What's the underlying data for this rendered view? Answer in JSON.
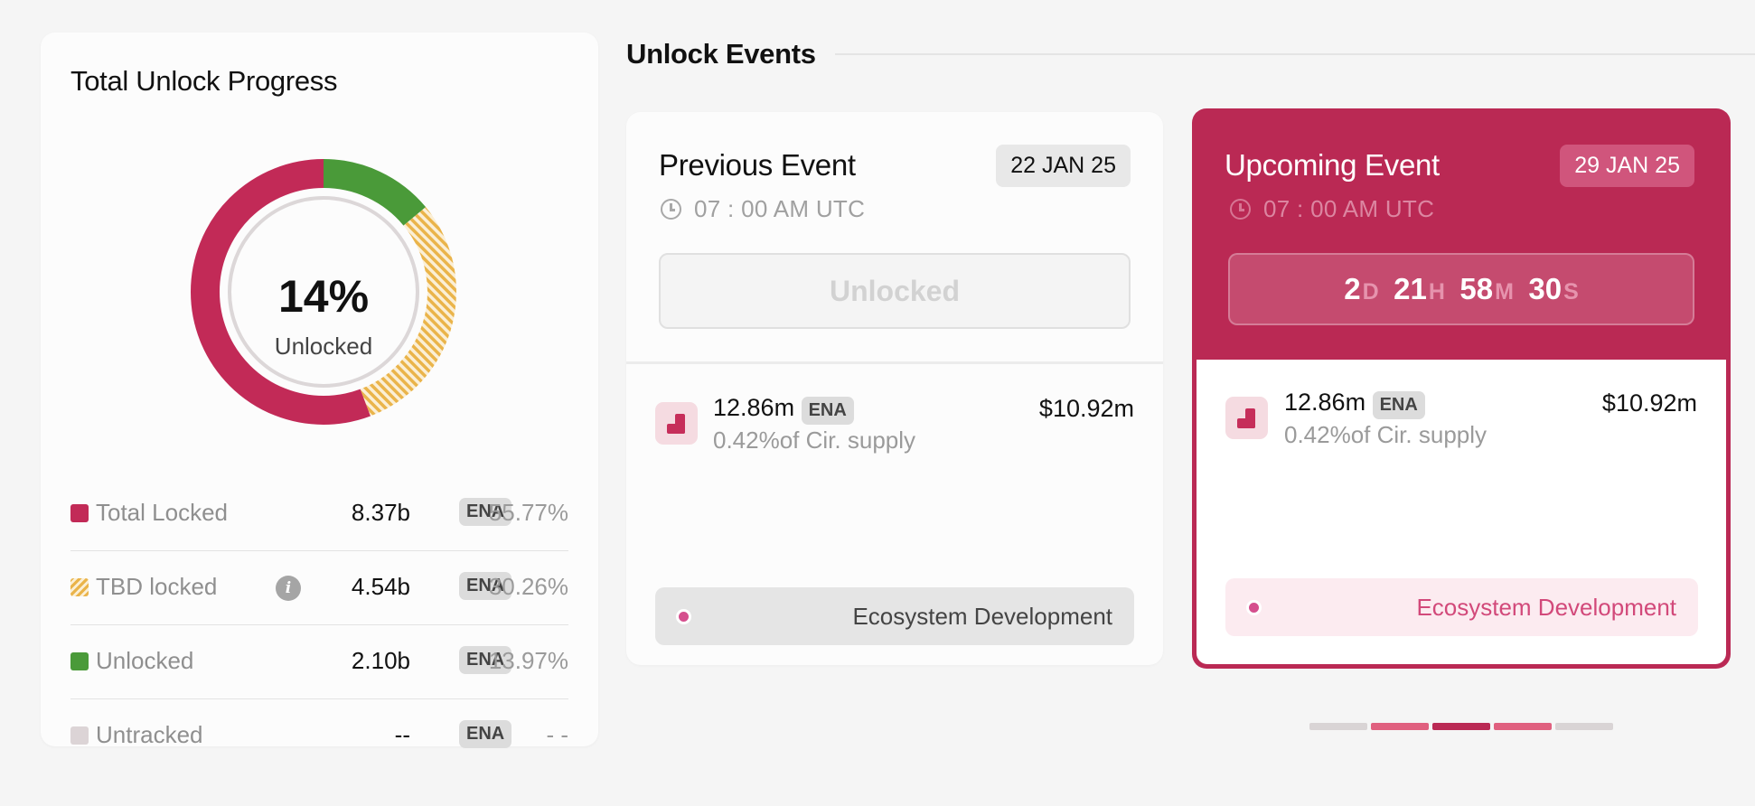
{
  "total_progress": {
    "title": "Total Unlock Progress",
    "percent_label": "14%",
    "center_label": "Unlocked",
    "segments": [
      {
        "name": "Unlocked",
        "fraction": 0.1397,
        "color": "#4a9a39"
      },
      {
        "name": "TBD locked",
        "fraction": 0.3026,
        "color": "#eab44a"
      },
      {
        "name": "Total Locked",
        "fraction": 0.5577,
        "color": "#c22a57"
      }
    ],
    "legend": [
      {
        "label": "Total Locked",
        "amount": "8.37b",
        "token": "ENA",
        "pct": "55.77%",
        "color": "#c22a57",
        "info": ""
      },
      {
        "label": "TBD locked",
        "amount": "4.54b",
        "token": "ENA",
        "pct": "30.26%",
        "color": "#eab44a",
        "info": "i"
      },
      {
        "label": "Unlocked",
        "amount": "2.10b",
        "token": "ENA",
        "pct": "13.97%",
        "color": "#4a9a39",
        "info": ""
      },
      {
        "label": "Untracked",
        "amount": "--",
        "token": "ENA",
        "pct": "- -",
        "color": "#dcd4d6",
        "info": ""
      }
    ]
  },
  "events": {
    "title": "Unlock Events",
    "previous": {
      "title": "Previous Event",
      "date": "22 JAN 25",
      "time": "07 : 00 AM UTC",
      "status": "Unlocked",
      "amount": "12.86m",
      "token": "ENA",
      "supply": "0.42%of Cir. supply",
      "usd": "$10.92m",
      "category": "Ecosystem Development"
    },
    "upcoming": {
      "title": "Upcoming Event",
      "date": "29 JAN 25",
      "time": "07 : 00 AM UTC",
      "countdown": {
        "d": "2",
        "d_unit": "D",
        "h": "21",
        "h_unit": "H",
        "m": "58",
        "m_unit": "M",
        "s": "30",
        "s_unit": "S"
      },
      "amount": "12.86m",
      "token": "ENA",
      "supply": "0.42%of Cir. supply",
      "usd": "$10.92m",
      "category": "Ecosystem Development"
    },
    "pager": {
      "count": 5,
      "active_index": 2
    }
  },
  "colors": {
    "brand": "#ba2954",
    "locked": "#c22a57",
    "tbd": "#eab44a",
    "unlocked": "#4a9a39",
    "untracked": "#dcd4d6",
    "pager_active": "#ba2954",
    "pager_near": "#e0607f",
    "pager_idle": "#d9d4d5"
  },
  "icons": {
    "clock": "clock-icon",
    "info": "info-icon",
    "allocation": "allocation-icon",
    "category_dot": "category-dot-icon"
  }
}
